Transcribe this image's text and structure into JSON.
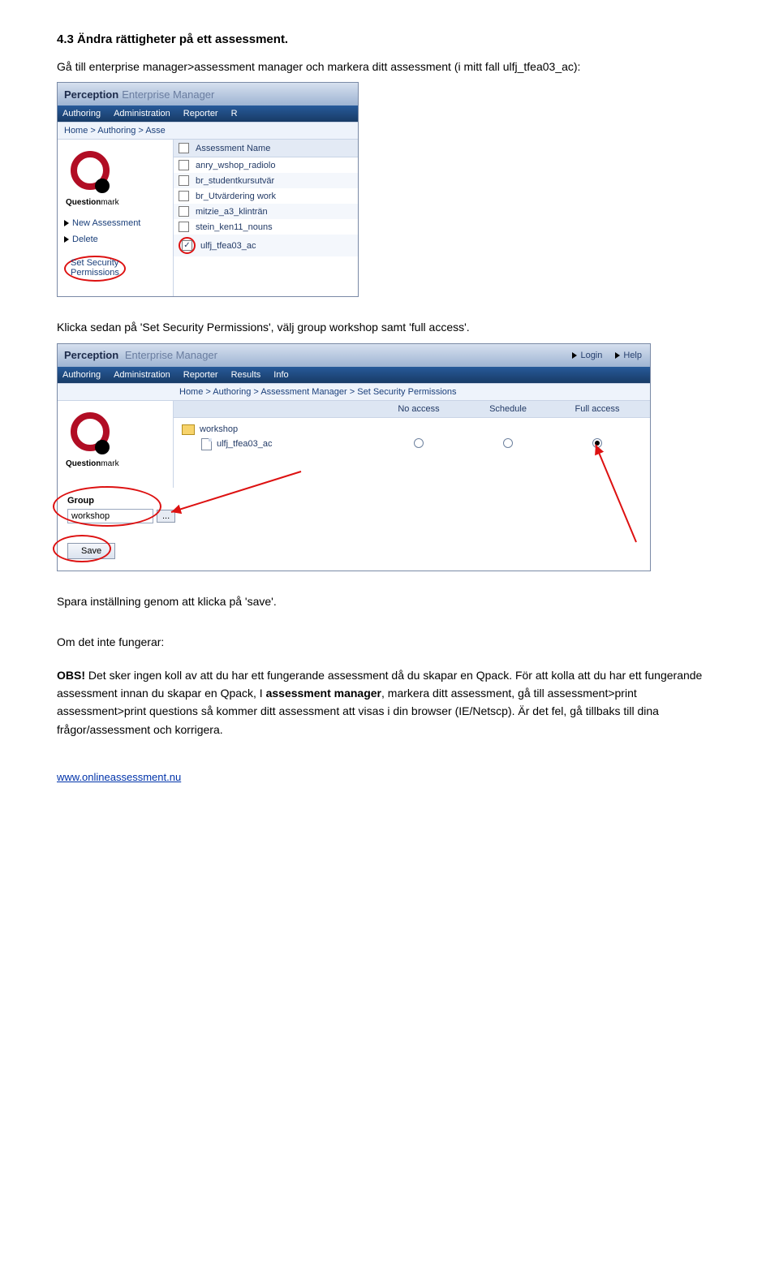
{
  "doc": {
    "heading": "4.3 Ändra rättigheter på ett assessment.",
    "p1": "Gå till enterprise manager>assessment manager och markera ditt assessment (i mitt fall ulfj_tfea03_ac):",
    "p2": "Klicka sedan på 'Set Security Permissions', välj group workshop samt 'full access'.",
    "p3": "Spara inställning genom att klicka på 'save'.",
    "p_trouble_head": "Om det inte fungerar:",
    "p_obs": "OBS!",
    "p4a": " Det sker ingen koll av att du har ett fungerande assessment då du skapar en Qpack. För att kolla att du har ett fungerande assessment innan du skapar en Qpack, I ",
    "p4b": "assessment manager",
    "p4c": ", markera ditt assessment, gå till assessment>print assessment>print questions så kommer ditt assessment att visas i din browser (IE/Netscp). Är det fel, gå tillbaks till dina frågor/assessment och korrigera.",
    "footer_link": "www.onlineassessment.nu"
  },
  "pem1": {
    "title_main": "Perception",
    "title_sub": "Enterprise Manager",
    "menu": [
      "Authoring",
      "Administration",
      "Reporter",
      "R"
    ],
    "breadcrumb": [
      "Home",
      "Authoring",
      "Asse"
    ],
    "brand": "Questionmark",
    "left_links": {
      "new_assessment": "New Assessment",
      "delete": "Delete",
      "set_security": "Set Security",
      "permissions": "Permissions"
    },
    "column_header": "Assessment Name",
    "rows": [
      {
        "label": "anry_wshop_radiolo",
        "checked": false
      },
      {
        "label": "br_studentkursutvär",
        "checked": false
      },
      {
        "label": "br_Utvärdering work",
        "checked": false
      },
      {
        "label": "mitzie_a3_klinträn",
        "checked": false
      },
      {
        "label": "stein_ken11_nouns",
        "checked": false
      },
      {
        "label": "ulfj_tfea03_ac",
        "checked": true
      }
    ]
  },
  "pem2": {
    "title_main": "Perception",
    "title_sub": "Enterprise Manager",
    "top_links": {
      "login": "Login",
      "help": "Help"
    },
    "menu": [
      "Authoring",
      "Administration",
      "Reporter",
      "Results",
      "Info"
    ],
    "breadcrumb": [
      "Home",
      "Authoring",
      "Assessment Manager",
      "Set Security Permissions"
    ],
    "brand": "Questionmark",
    "perm_headers": {
      "col1": "",
      "no_access": "No access",
      "schedule": "Schedule",
      "full_access": "Full access"
    },
    "folder_label": "workshop",
    "item_label": "ulfj_tfea03_ac",
    "selected_permission": "full_access",
    "group_label": "Group",
    "group_value": "workshop",
    "browse_btn": "...",
    "save_btn": "Save"
  }
}
